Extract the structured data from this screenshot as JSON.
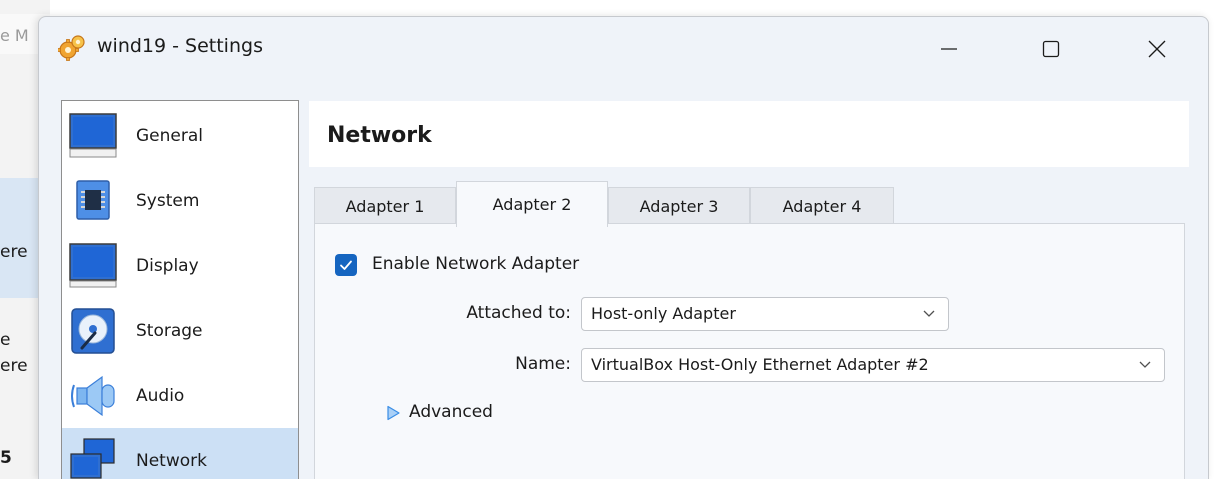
{
  "background_window": {
    "title_fragment": "e M",
    "list_fragments": [
      "ere",
      "e",
      "ere",
      "5"
    ]
  },
  "dialog": {
    "title": "wind19 - Settings",
    "window_buttons": {
      "minimize": "minimize-icon",
      "maximize": "maximize-icon",
      "close": "close-icon"
    }
  },
  "categories": [
    {
      "label": "General",
      "icon": "general-monitor-icon"
    },
    {
      "label": "System",
      "icon": "system-chip-icon"
    },
    {
      "label": "Display",
      "icon": "display-monitor-icon"
    },
    {
      "label": "Storage",
      "icon": "storage-disk-icon"
    },
    {
      "label": "Audio",
      "icon": "audio-speaker-icon"
    },
    {
      "label": "Network",
      "icon": "network-icon",
      "selected": true
    }
  ],
  "page": {
    "title": "Network",
    "tabs": [
      {
        "label": "Adapter 1",
        "active": false
      },
      {
        "label": "Adapter 2",
        "active": true
      },
      {
        "label": "Adapter 3",
        "active": false
      },
      {
        "label": "Adapter 4",
        "active": false
      }
    ],
    "enable_adapter": {
      "label": "Enable Network Adapter",
      "checked": true
    },
    "attached_to": {
      "label": "Attached to:",
      "value": "Host-only Adapter"
    },
    "name": {
      "label": "Name:",
      "value": "VirtualBox Host-Only Ethernet Adapter #2"
    },
    "advanced": {
      "label": "Advanced",
      "expanded": false
    }
  },
  "colors": {
    "accent": "#1565c0",
    "selection": "#cce0f5",
    "dialog_bg": "#eff3f9",
    "advanced_arrow": "#3a8ee6"
  }
}
